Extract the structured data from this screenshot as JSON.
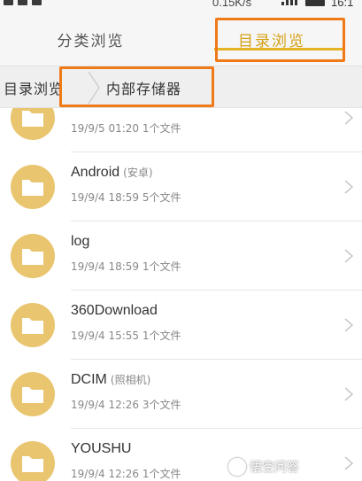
{
  "status_bar": {
    "network_speed": "0.15K/s",
    "clock": "16:1"
  },
  "tabs": [
    {
      "label": "分类浏览",
      "active": false
    },
    {
      "label": "目录浏览",
      "active": true
    }
  ],
  "colors": {
    "accent": "#e6b325",
    "highlight_box": "#f07a18",
    "folder_icon_bg": "#e9c56f"
  },
  "breadcrumb": {
    "root": "目录浏览",
    "current": "内部存储器"
  },
  "files": [
    {
      "name": "",
      "tag": "",
      "meta": "19/9/5 01:20 1个文件",
      "icon": "folder-icon"
    },
    {
      "name": "Android",
      "tag": "(安卓)",
      "meta": "19/9/4 18:59 5个文件",
      "icon": "folder-icon"
    },
    {
      "name": "log",
      "tag": "",
      "meta": "19/9/4 18:59 1个文件",
      "icon": "folder-icon"
    },
    {
      "name": "360Download",
      "tag": "",
      "meta": "19/9/4 15:55 1个文件",
      "icon": "folder-icon"
    },
    {
      "name": "DCIM",
      "tag": "(照相机)",
      "meta": "19/9/4 12:26 3个文件",
      "icon": "folder-icon"
    },
    {
      "name": "YOUSHU",
      "tag": "",
      "meta": "19/9/4 12:26 1个文件",
      "icon": "folder-icon"
    }
  ],
  "watermark": "悟空问答"
}
